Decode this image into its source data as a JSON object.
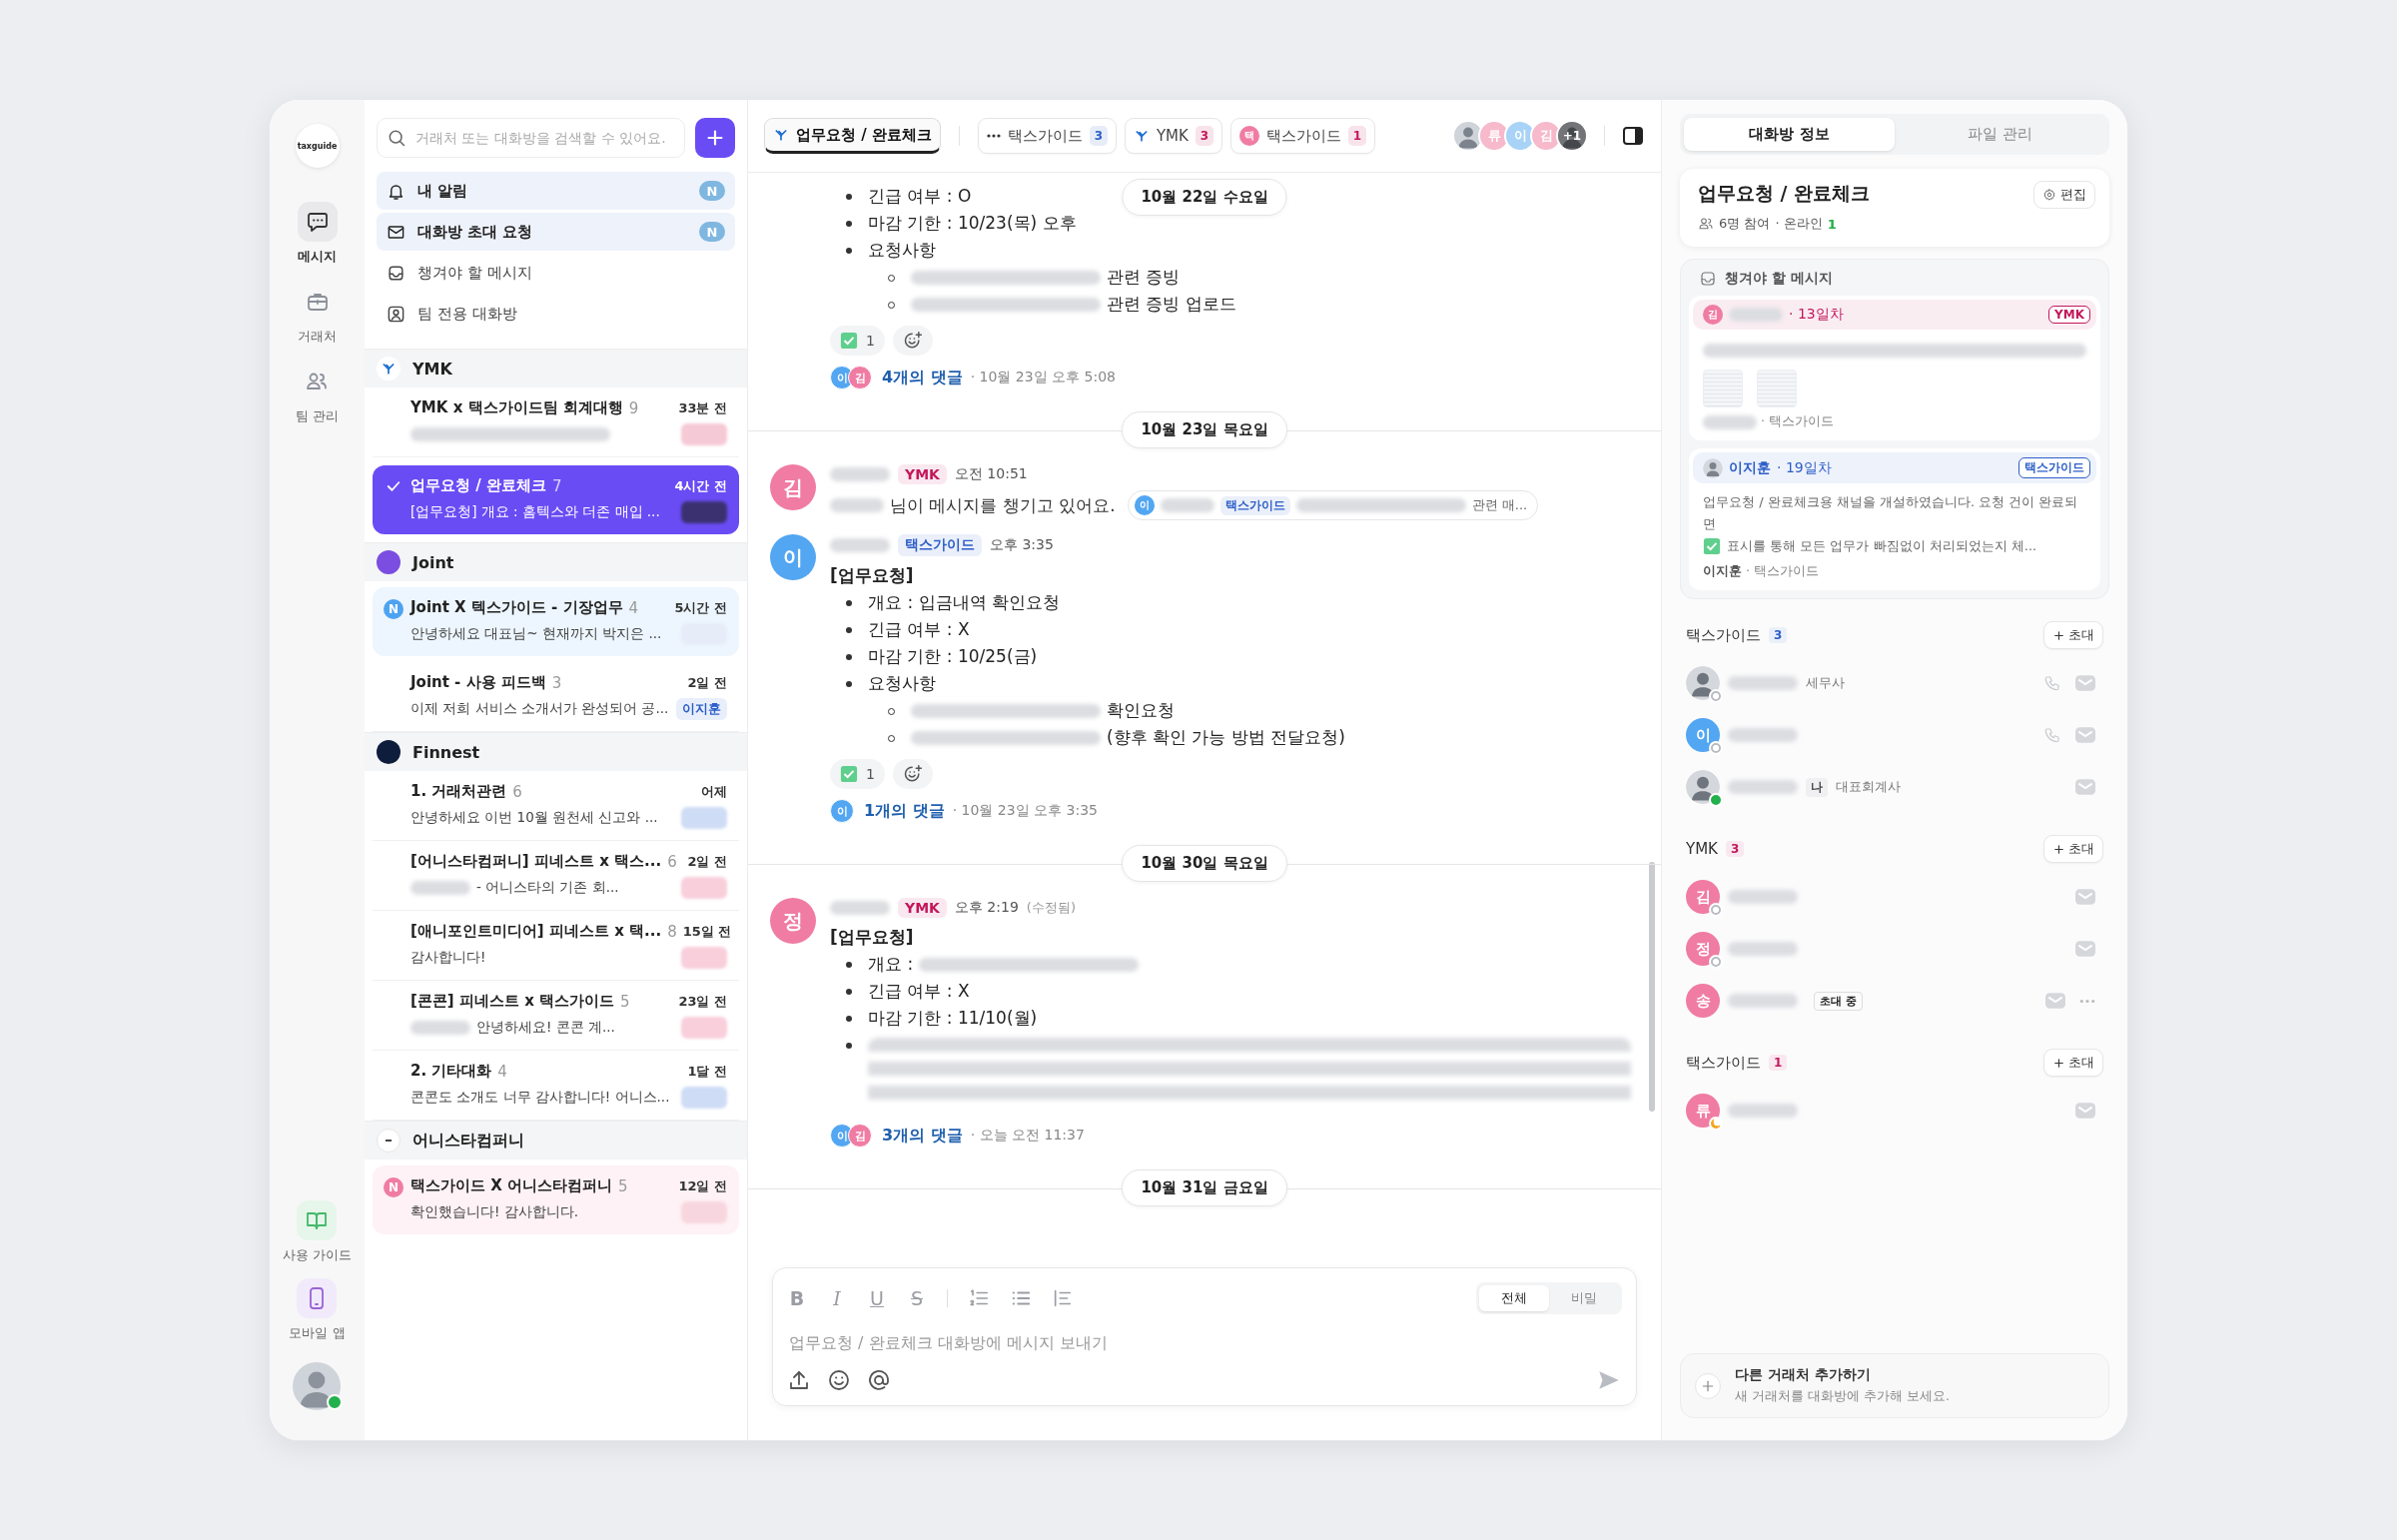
{
  "rail": {
    "logo": "taxguide",
    "items": [
      {
        "label": "메시지",
        "selected": true
      },
      {
        "label": "거래처",
        "selected": false
      },
      {
        "label": "팀 관리",
        "selected": false
      }
    ],
    "bottom": [
      {
        "label": "사용 가이드"
      },
      {
        "label": "모바일 앱"
      }
    ],
    "user_online": true
  },
  "search": {
    "placeholder": "거래처 또는 대화방을 검색할 수 있어요."
  },
  "shortcuts": [
    {
      "label": "내 알림",
      "badge": "N",
      "highlighted": true
    },
    {
      "label": "대화방 초대 요청",
      "badge": "N",
      "highlighted": true
    },
    {
      "label": "챙겨야 할 메시지",
      "highlighted": false
    },
    {
      "label": "팀 전용 대화방",
      "highlighted": false
    }
  ],
  "groups": [
    {
      "name": "YMK",
      "rooms": [
        {
          "title": "YMK x 택스가이드팀 회계대행",
          "count": "9",
          "time": "33분 전",
          "tag": {
            "color": "#f6c9d6"
          },
          "selected": false
        },
        {
          "title": "업무요청 / 완료체크",
          "count": "7",
          "time": "4시간 전",
          "preview": "[업무요청] 개요 : 홈텍스와 더존 매입 ...",
          "tag": {
            "color": "#3b3170"
          },
          "selected": true
        }
      ]
    },
    {
      "name": "Joint",
      "rooms": [
        {
          "title": "Joint X 텍스가이드 - 기장업무",
          "count": "4",
          "time": "5시간 전",
          "preview": "안녕하세요 대표님~ 현재까지 박지은 ...",
          "tag": {
            "color": "#e6ecf8"
          },
          "badge": {
            "label": "N",
            "color": "#4da3f0"
          },
          "selected": false
        },
        {
          "title": "Joint - 사용 피드백",
          "count": "3",
          "time": "2일 전",
          "preview": "이제 저희 서비스 소개서가 완성되어 공...",
          "tag": {
            "label": "이지훈"
          },
          "selected": false
        }
      ]
    },
    {
      "name": "Finnest",
      "rooms": [
        {
          "title": "1. 거래처관련",
          "count": "6",
          "time": "어제",
          "preview": "안녕하세요  이번 10월 원천세 신고와 ...",
          "tag": {
            "color": "#cfdcf5"
          },
          "selected": false
        },
        {
          "title": "[어니스타컴퍼니] 피네스트 x 택스...",
          "count": "6",
          "time": "2일 전",
          "preview": "- 어니스타의 기존 회...",
          "preview_blurred_lead": true,
          "tag": {
            "color": "#f8cfdb"
          },
          "selected": false
        },
        {
          "title": "[애니포인트미디어] 피네스트 x 택...",
          "count": "8",
          "time": "15일 전",
          "preview": "감사합니다!",
          "tag": {
            "color": "#f8cfdb"
          },
          "selected": false
        },
        {
          "title": "[콘콘] 피네스트 x 택스가이드",
          "count": "5",
          "time": "23일 전",
          "preview": "안녕하세요! 콘콘 계...",
          "preview_blurred_lead": true,
          "tag": {
            "color": "#f8cfdb"
          },
          "selected": false
        },
        {
          "title": "2. 기타대화",
          "count": "4",
          "time": "1달 전",
          "preview": "콘콘도 소개도 너무 감사합니다! 어니스...",
          "tag": {
            "color": "#cfdcf5"
          },
          "selected": false
        }
      ]
    },
    {
      "name": "어니스타컴퍼니",
      "rooms": [
        {
          "title": "택스가이드 X 어니스타컴퍼니",
          "count": "5",
          "time": "12일 전",
          "preview": "확인했습니다! 감사합니다.",
          "tag": {
            "color": "#f8d6df"
          },
          "badge": {
            "label": "N",
            "color": "#f07ca3"
          },
          "selected": false
        }
      ]
    }
  ],
  "tabs": [
    {
      "label": "업무요청 / 완료체크",
      "kind": "room",
      "selected": true
    },
    {
      "label": "택스가이드",
      "kind": "team",
      "count": {
        "label": "3",
        "color": "#2d5fc8"
      },
      "selected": false
    },
    {
      "label": "YMK",
      "kind": "company",
      "count": {
        "label": "3",
        "color": "#c2185b"
      },
      "selected": false
    },
    {
      "label": "택스가이드",
      "kind": "member",
      "avatar": "택",
      "count": {
        "label": "1",
        "color": "#c2185b"
      },
      "selected": false
    }
  ],
  "participants": [
    {
      "kind": "photo"
    },
    {
      "kind": "initial",
      "text": "류",
      "color": "#f7b9cc"
    },
    {
      "kind": "initial",
      "text": "이",
      "color": "#a8d3f7"
    },
    {
      "kind": "initial",
      "text": "김",
      "color": "#f7b9cc"
    },
    {
      "kind": "photo",
      "overlay": "+1"
    }
  ],
  "sticky_date": "10월 22일 수요일",
  "timeline": [
    {
      "kind": "continuation",
      "bullets": [
        {
          "kind": "text",
          "text": "긴급 여부 : O"
        },
        {
          "kind": "text",
          "text": "마감 기한 : 10/23(목) 오후"
        },
        {
          "kind": "text",
          "text": "요청사항",
          "children": [
            {
              "kind": "blur_lead",
              "text": "관련 증빙"
            },
            {
              "kind": "blur_lead",
              "text": "관련 증빙 업로드"
            }
          ]
        }
      ],
      "reactions": [
        {
          "kind": "check",
          "count": "1"
        },
        {
          "kind": "add"
        }
      ],
      "thread": {
        "avatars": [
          {
            "text": "이",
            "color": "#52a6f2"
          },
          {
            "text": "김",
            "color": "#f07ca3"
          }
        ],
        "label": "4개의 댓글",
        "time": "· 10월 23일 오후 5:08"
      }
    },
    {
      "kind": "date",
      "label": "10월 23일 목요일"
    },
    {
      "kind": "notice",
      "avatar": {
        "text": "김",
        "color": "#f07ca3"
      },
      "tag": {
        "label": "YMK",
        "color": "#c2185b"
      },
      "time": "오전 10:51",
      "text": "님이 메시지를 챙기고 있어요.",
      "quote": {
        "avatar": {
          "text": "이",
          "color": "#52a6f2"
        },
        "tag": {
          "label": "택스가이드",
          "color": "#2d5fc8"
        },
        "text": "관련 매..."
      }
    },
    {
      "kind": "message",
      "avatar": {
        "text": "이",
        "color": "#52a6f2"
      },
      "tag": {
        "label": "택스가이드",
        "color": "#2d5fc8"
      },
      "time": "오후 3:35",
      "heading": "[업무요청]",
      "bullets": [
        {
          "kind": "text",
          "text": "개요 : 입금내역 확인요청"
        },
        {
          "kind": "text",
          "text": "긴급 여부 : X"
        },
        {
          "kind": "text",
          "text": "마감 기한 : 10/25(금)"
        },
        {
          "kind": "text",
          "text": "요청사항",
          "children": [
            {
              "kind": "blur_lead",
              "text": "확인요청"
            },
            {
              "kind": "blur_lead",
              "text": "(향후 확인 가능 방법 전달요청)"
            }
          ]
        }
      ],
      "reactions": [
        {
          "kind": "check",
          "count": "1"
        },
        {
          "kind": "add"
        }
      ],
      "thread": {
        "avatars": [
          {
            "text": "이",
            "color": "#52a6f2"
          }
        ],
        "label": "1개의 댓글",
        "time": "· 10월 23일 오후 3:35"
      }
    },
    {
      "kind": "date",
      "label": "10월 30일 목요일"
    },
    {
      "kind": "message",
      "avatar": {
        "text": "정",
        "color": "#f07ca3"
      },
      "tag": {
        "label": "YMK",
        "color": "#c2185b"
      },
      "time": "오후 2:19",
      "edited": "(수정됨)",
      "heading": "[업무요청]",
      "bullets": [
        {
          "kind": "blur_trail",
          "text": "개요 :"
        },
        {
          "kind": "text",
          "text": "긴급 여부 : X"
        },
        {
          "kind": "text",
          "text": "마감 기한 : 11/10(월)"
        },
        {
          "kind": "blurred"
        }
      ],
      "thread": {
        "avatars": [
          {
            "text": "이",
            "color": "#52a6f2"
          },
          {
            "text": "김",
            "color": "#f07ca3"
          }
        ],
        "label": "3개의 댓글",
        "time": "· 오늘 오전 11:37"
      }
    },
    {
      "kind": "date",
      "label": "10월 31일 금요일"
    }
  ],
  "composer": {
    "format_tools": [
      "B",
      "I",
      "U",
      "S"
    ],
    "visibility": [
      {
        "label": "전체",
        "selected": true
      },
      {
        "label": "비밀",
        "selected": false
      }
    ],
    "placeholder": "업무요청 / 완료체크 대화방에 메시지 보내기"
  },
  "panel": {
    "tabs": [
      {
        "label": "대화방 정보",
        "selected": true
      },
      {
        "label": "파일 관리",
        "selected": false
      }
    ],
    "room": {
      "title": "업무요청 / 완료체크",
      "edit": "편집",
      "members": "6명 참여",
      "online_label": "· 온라인",
      "online_count": "1"
    },
    "pinned": {
      "title": "챙겨야 할 메시지",
      "items": [
        {
          "avatar": {
            "kind": "initial",
            "text": "김",
            "color": "#f07ca3"
          },
          "day": "· 13일차",
          "tag": {
            "label": "YMK",
            "color": "#c2185b"
          },
          "attachments": true,
          "footer": "· 택스가이드"
        },
        {
          "avatar": {
            "kind": "photo"
          },
          "name": "이지훈",
          "day": "· 19일차",
          "tag": {
            "label": "택스가이드",
            "color": "#2d5fc8"
          },
          "body": [
            "업무요청 / 완료체크용 채널을 개설하였습니다.  요청 건이 완료되면",
            "표시를 통해  모든 업무가 빠짐없이 처리되었는지 체..."
          ],
          "footer_name": "이지훈",
          "footer": "· 택스가이드"
        }
      ]
    },
    "member_groups": [
      {
        "title": "택스가이드",
        "count": "3",
        "color": "#2d5fc8",
        "invite": "초대",
        "members": [
          {
            "avatar": {
              "kind": "photo"
            },
            "online": false,
            "role": "세무사",
            "call": true
          },
          {
            "avatar": {
              "kind": "initial",
              "text": "이",
              "color": "#52a6f2"
            },
            "online": false,
            "call": true
          },
          {
            "avatar": {
              "kind": "photo"
            },
            "online": true,
            "me": "나",
            "role": "대표회계사"
          }
        ]
      },
      {
        "title": "YMK",
        "count": "3",
        "color": "#c2185b",
        "invite": "초대",
        "members": [
          {
            "avatar": {
              "kind": "initial",
              "text": "김",
              "color": "#f07ca3"
            },
            "online": false
          },
          {
            "avatar": {
              "kind": "initial",
              "text": "정",
              "color": "#f07ca3"
            },
            "online": false
          },
          {
            "avatar": {
              "kind": "initial",
              "text": "송",
              "color": "#f07ca3"
            },
            "pending": "초대 중",
            "more": true
          }
        ]
      },
      {
        "title": "택스가이드",
        "count": "1",
        "color": "#c2185b",
        "invite": "초대",
        "members": [
          {
            "avatar": {
              "kind": "initial",
              "text": "류",
              "color": "#f07ca3"
            },
            "away": true
          }
        ]
      }
    ],
    "add_card": {
      "title": "다른 거래처 추가하기",
      "subtitle": "새 거래처를 대화방에 추가해 보세요."
    }
  }
}
